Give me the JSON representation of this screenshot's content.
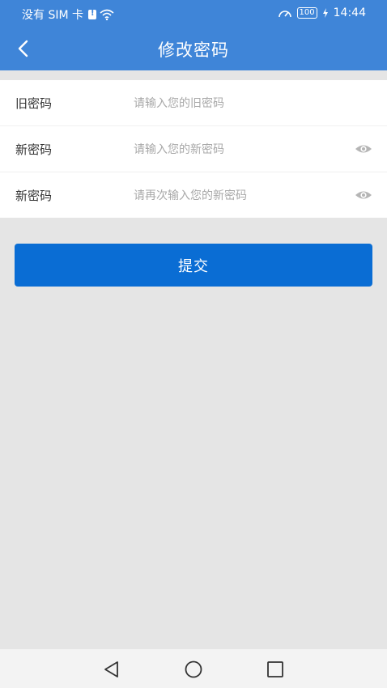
{
  "status_bar": {
    "carrier": "没有 SIM 卡",
    "battery": "100",
    "time": "14:44",
    "icons": [
      "sim-alert-icon",
      "wifi-icon",
      "speedometer-icon",
      "battery-icon",
      "charging-icon"
    ]
  },
  "app_bar": {
    "title": "修改密码",
    "back_icon": "back-arrow-icon"
  },
  "form": {
    "rows": [
      {
        "label": "旧密码",
        "placeholder": "请输入您的旧密码",
        "value": "",
        "eye": false
      },
      {
        "label": "新密码",
        "placeholder": "请输入您的新密码",
        "value": "",
        "eye": true
      },
      {
        "label": "新密码",
        "placeholder": "请再次输入您的新密码",
        "value": "",
        "eye": true
      }
    ]
  },
  "submit_label": "提交",
  "nav_bar": {
    "icons": [
      "back-triangle-icon",
      "home-circle-icon",
      "recents-square-icon"
    ]
  },
  "colors": {
    "primary": "#3f85d8",
    "button": "#0a6dd4",
    "background": "#e5e5e5",
    "placeholder": "#a8a8a8"
  }
}
